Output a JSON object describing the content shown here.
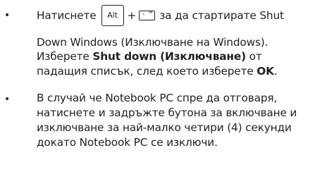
{
  "bullets": [
    "•",
    "•"
  ],
  "item1": {
    "prefix": "Натиснете",
    "alt_key": "Alt",
    "plus": "+",
    "f4_key_glyph": "☾",
    "f4_key_label": "f4",
    "suffix": "за да стартирате Shut",
    "line2": "Down Windows (Изключване на Windows).",
    "line3_pre": "Изберете ",
    "line3_bold": "Shut down (Изключване)",
    "line3_post": " от",
    "line4_pre": "падащия списък, след което изберете ",
    "line4_bold": "OK",
    "line4_post": "."
  },
  "item2": {
    "lines": [
      "В случай че Notebook PC спре да отговаря,",
      "натиснете и задръжте бутона за включване и",
      "изключване за най-малко четири (4) секунди",
      "докато Notebook PC се изключи."
    ]
  }
}
